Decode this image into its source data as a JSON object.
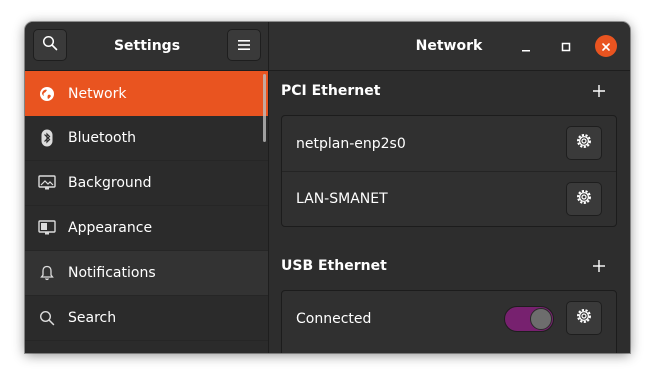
{
  "window": {
    "sidebar_title": "Settings",
    "panel_title": "Network"
  },
  "headerbar": {
    "search_icon": "search-icon",
    "menu_icon": "hamburger-menu-icon",
    "minimize_icon": "minimize-icon",
    "maximize_icon": "maximize-icon",
    "close_icon": "close-icon"
  },
  "sidebar": {
    "items": [
      {
        "label": "Network",
        "icon": "globe-icon",
        "active": true
      },
      {
        "label": "Bluetooth",
        "icon": "bluetooth-icon",
        "active": false
      },
      {
        "label": "Background",
        "icon": "monitor-icon",
        "active": false
      },
      {
        "label": "Appearance",
        "icon": "appearance-icon",
        "active": false
      },
      {
        "label": "Notifications",
        "icon": "bell-icon",
        "active": false
      },
      {
        "label": "Search",
        "icon": "search-icon",
        "active": false
      }
    ]
  },
  "content": {
    "pci": {
      "title": "PCI Ethernet",
      "connections": [
        {
          "label": "netplan-enp2s0"
        },
        {
          "label": "LAN-SMANET"
        }
      ]
    },
    "usb": {
      "title": "USB Ethernet",
      "connections": [
        {
          "label": "Connected",
          "switch_on": true
        }
      ]
    }
  },
  "colors": {
    "accent": "#e95420",
    "switch_on": "#77216f",
    "background": "#2d2d2d",
    "sidebar": "#2b2b2b"
  }
}
